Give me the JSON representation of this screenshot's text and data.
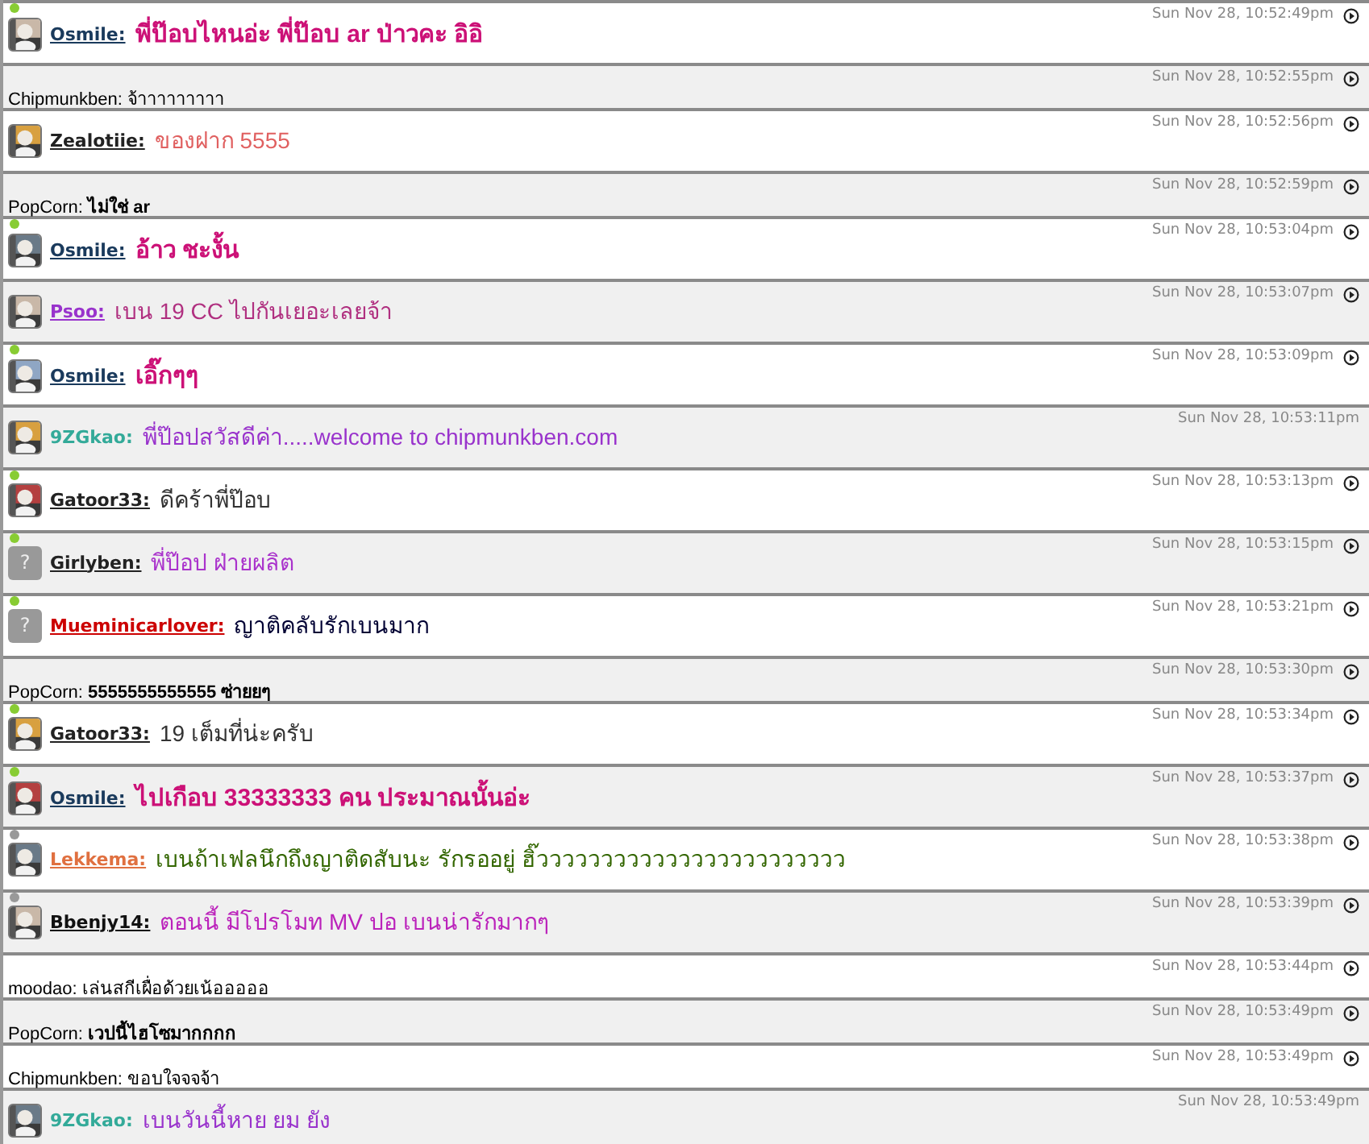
{
  "messages": [
    {
      "kind": "post",
      "status": {
        "color": "#88cc33"
      },
      "sender": {
        "text": "Osmile:",
        "color": "#1a3a5c",
        "link": true
      },
      "message": {
        "text": "พี่ป๊อบไหนอ่ะ พี่ป๊อบ ar ป่าวคะ อิอิ",
        "color": "#cc1177",
        "bold": true
      },
      "time": "Sun Nov 28, 10:52:49pm",
      "play_button": true
    },
    {
      "kind": "plain",
      "sender": {
        "text": "Chipmunkben:"
      },
      "message": {
        "text": "จ้าาาาาาาาา",
        "bold": false
      },
      "time": "Sun Nov 28, 10:52:55pm",
      "play_button": true
    },
    {
      "kind": "post",
      "sender": {
        "text": "Zealotiie:",
        "color": "#222222",
        "link": true
      },
      "message": {
        "text": "ของฝาก 5555",
        "color": "#e06060",
        "bold": false
      },
      "time": "Sun Nov 28, 10:52:56pm",
      "play_button": true
    },
    {
      "kind": "plain",
      "sender": {
        "text": "PopCorn:"
      },
      "message": {
        "text": "ไม่ใช่ ar",
        "bold": true
      },
      "time": "Sun Nov 28, 10:52:59pm",
      "play_button": true
    },
    {
      "kind": "post",
      "status": {
        "color": "#88cc33"
      },
      "sender": {
        "text": "Osmile:",
        "color": "#1a3a5c",
        "link": true
      },
      "message": {
        "text": "อ้าว ชะงั้น",
        "color": "#cc1177",
        "bold": true
      },
      "time": "Sun Nov 28, 10:53:04pm",
      "play_button": true
    },
    {
      "kind": "post",
      "sender": {
        "text": "Psoo:",
        "color": "#9933cc",
        "link": true
      },
      "message": {
        "text": "เบน 19 CC ไปกันเยอะเลยจ้า",
        "color": "#b03080",
        "bold": false
      },
      "time": "Sun Nov 28, 10:53:07pm",
      "play_button": true
    },
    {
      "kind": "post",
      "status": {
        "color": "#88cc33"
      },
      "sender": {
        "text": "Osmile:",
        "color": "#1a3a5c",
        "link": true
      },
      "message": {
        "text": "เอิ๊กๆๆ",
        "color": "#cc1177",
        "bold": true
      },
      "time": "Sun Nov 28, 10:53:09pm",
      "play_button": true
    },
    {
      "kind": "post",
      "sender": {
        "text": "9ZGkao:",
        "color": "#33aa99",
        "link": false
      },
      "message": {
        "text": "พี่ป๊อปสวัสดีค่า.....welcome  to  chipmunkben.com",
        "color": "#9933cc",
        "bold": false
      },
      "time": "Sun Nov 28, 10:53:11pm",
      "play_button": false
    },
    {
      "kind": "post",
      "status": {
        "color": "#88cc33"
      },
      "sender": {
        "text": "Gatoor33:",
        "color": "#222222",
        "link": true
      },
      "message": {
        "text": "ดีคร้าพี่ป๊อบ",
        "color": "#333333",
        "bold": false
      },
      "time": "Sun Nov 28, 10:53:13pm",
      "play_button": true
    },
    {
      "kind": "post",
      "status": {
        "color": "#88cc33"
      },
      "avatar": {
        "kind": "placeholder",
        "label": "?"
      },
      "sender": {
        "text": "Girlyben:",
        "color": "#222222",
        "link": true
      },
      "message": {
        "text": "พี่ป๊อป ฝ่ายผลิต",
        "color": "#aa33cc",
        "bold": false
      },
      "time": "Sun Nov 28, 10:53:15pm",
      "play_button": true
    },
    {
      "kind": "post",
      "status": {
        "color": "#88cc33"
      },
      "avatar": {
        "kind": "placeholder",
        "label": "?"
      },
      "sender": {
        "text": "Mueminicarlover:",
        "color": "#cc0000",
        "link": true
      },
      "message": {
        "text": "ญาติคลับรักเบนมาก",
        "color": "#000033",
        "bold": false
      },
      "time": "Sun Nov 28, 10:53:21pm",
      "play_button": true
    },
    {
      "kind": "plain",
      "sender": {
        "text": "PopCorn:"
      },
      "message": {
        "text": "5555555555555 ซ่ายยๆ",
        "bold": true
      },
      "time": "Sun Nov 28, 10:53:30pm",
      "play_button": true
    },
    {
      "kind": "post",
      "status": {
        "color": "#88cc33"
      },
      "sender": {
        "text": "Gatoor33:",
        "color": "#222222",
        "link": true
      },
      "message": {
        "text": "19  เต็มที่น่ะครับ",
        "color": "#333333",
        "bold": false
      },
      "time": "Sun Nov 28, 10:53:34pm",
      "play_button": true
    },
    {
      "kind": "post",
      "status": {
        "color": "#88cc33"
      },
      "sender": {
        "text": "Osmile:",
        "color": "#1a3a5c",
        "link": true
      },
      "message": {
        "text": "ไปเกือบ 33333333 คน ประมาณนั้นอ่ะ",
        "color": "#cc1177",
        "bold": true
      },
      "time": "Sun Nov 28, 10:53:37pm",
      "play_button": true
    },
    {
      "kind": "post",
      "status": {
        "color": "#999999"
      },
      "sender": {
        "text": "Lekkema:",
        "color": "#e07040",
        "link": true
      },
      "message": {
        "text": "เบนถ้าเฟลนึกถึงญาติดสับนะ รักรออยู่ ฮิ๊วววววววววววววววววววววววว",
        "color": "#336600",
        "bold": false
      },
      "time": "Sun Nov 28, 10:53:38pm",
      "play_button": true
    },
    {
      "kind": "post",
      "status": {
        "color": "#999999"
      },
      "sender": {
        "text": "Bbenjy14:",
        "color": "#111111",
        "link": true
      },
      "message": {
        "text": "ตอนนี้ มีโปรโมท MV ปอ  เบนน่ารักมากๆ",
        "color": "#bb22bb",
        "bold": false
      },
      "time": "Sun Nov 28, 10:53:39pm",
      "play_button": true
    },
    {
      "kind": "plain",
      "sender": {
        "text": "moodao:"
      },
      "message": {
        "text": "เล่นสกีเผื่อด้วยเน้อออออ",
        "bold": false
      },
      "time": "Sun Nov 28, 10:53:44pm",
      "play_button": true
    },
    {
      "kind": "plain",
      "sender": {
        "text": "PopCorn:"
      },
      "message": {
        "text": "เวปนี้ไฮโซมากกกก",
        "bold": true
      },
      "time": "Sun Nov 28, 10:53:49pm",
      "play_button": true
    },
    {
      "kind": "plain",
      "sender": {
        "text": "Chipmunkben:"
      },
      "message": {
        "text": "ขอบใจจจจ้า",
        "bold": false
      },
      "time": "Sun Nov 28, 10:53:49pm",
      "play_button": true
    },
    {
      "kind": "post",
      "sender": {
        "text": "9ZGkao:",
        "color": "#33aa99",
        "link": false
      },
      "message": {
        "text": "เบนวันนี้หาย ยม ยัง",
        "color": "#9933cc",
        "bold": false
      },
      "time": "Sun Nov 28, 10:53:49pm",
      "play_button": false
    }
  ]
}
